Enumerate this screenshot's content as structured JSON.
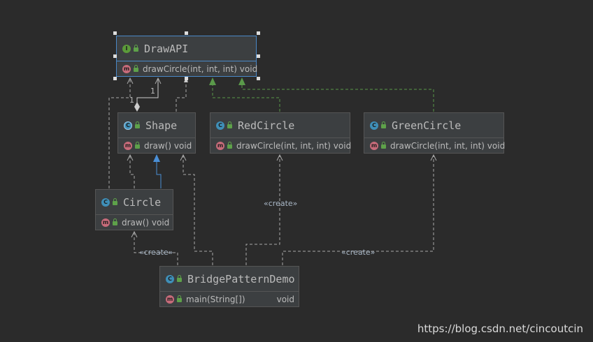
{
  "nodes": {
    "drawapi": {
      "title": "DrawAPI",
      "method": "drawCircle(int, int, int) void"
    },
    "shape": {
      "title": "Shape",
      "method": "draw() void"
    },
    "redcircle": {
      "title": "RedCircle",
      "method": "drawCircle(int, int, int) void"
    },
    "greencircle": {
      "title": "GreenCircle",
      "method": "drawCircle(int, int, int) void"
    },
    "circle": {
      "title": "Circle",
      "method": "draw() void"
    },
    "demo": {
      "title": "BridgePatternDemo",
      "method": "main(String[])",
      "return": "void"
    }
  },
  "edge_labels": {
    "create_red": "«create»",
    "create_circle": "«create»",
    "create_green": "«create»"
  },
  "multiplicity": {
    "upper": "1",
    "lower": "1"
  },
  "badges": {
    "interface": "I",
    "class": "C",
    "method": "m"
  },
  "colors": {
    "background": "#2b2b2b",
    "node_fill": "#3c3f41",
    "selection": "#4a88c7",
    "implements": "#5a9a4a",
    "extends": "#4a8fd6",
    "dependency": "#a9a9a9"
  },
  "watermark": "https://blog.csdn.net/cincoutcin"
}
